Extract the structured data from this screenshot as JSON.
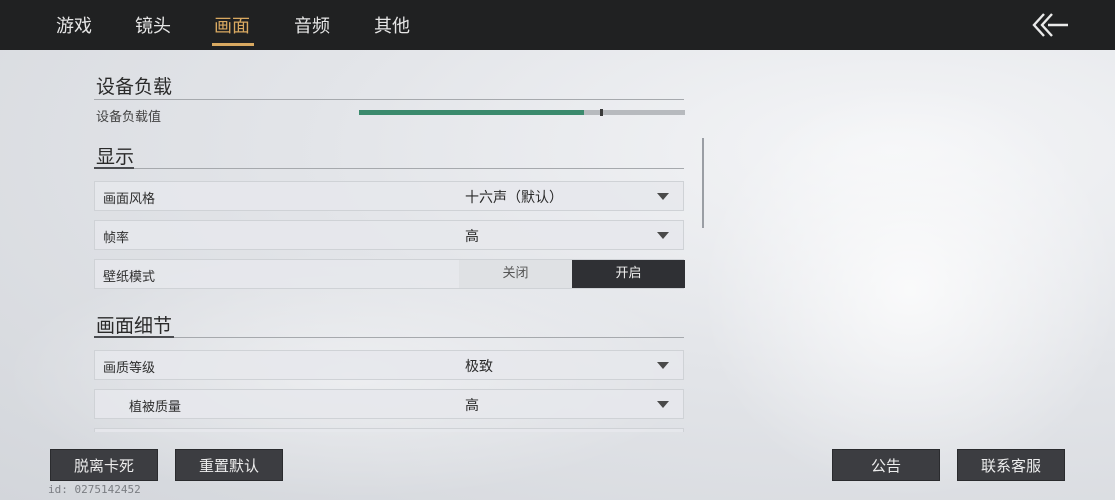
{
  "tabs": [
    {
      "label": "游戏"
    },
    {
      "label": "镜头"
    },
    {
      "label": "画面",
      "active": true
    },
    {
      "label": "音频"
    },
    {
      "label": "其他"
    }
  ],
  "back_icon": "double-chevron-left-icon",
  "device_load": {
    "title": "设备负载",
    "label": "设备负载值",
    "value_fraction": 0.69,
    "marker_fraction": 0.74,
    "fill_color": "#3b8a6d"
  },
  "display": {
    "title": "显示",
    "rows": [
      {
        "label": "画面风格",
        "value": "十六声（默认）",
        "type": "dropdown"
      },
      {
        "label": "帧率",
        "value": "高",
        "type": "dropdown"
      },
      {
        "label": "壁纸模式",
        "type": "toggle",
        "off_label": "关闭",
        "on_label": "开启",
        "selected": "开启"
      }
    ]
  },
  "detail": {
    "title": "画面细节",
    "rows": [
      {
        "label": "画质等级",
        "value": "极致",
        "type": "dropdown"
      },
      {
        "label": "植被质量",
        "value": "高",
        "type": "dropdown"
      }
    ]
  },
  "footer": {
    "unstuck": "脱离卡死",
    "reset": "重置默认",
    "notice": "公告",
    "support": "联系客服",
    "uid": "id: 0275142452"
  }
}
